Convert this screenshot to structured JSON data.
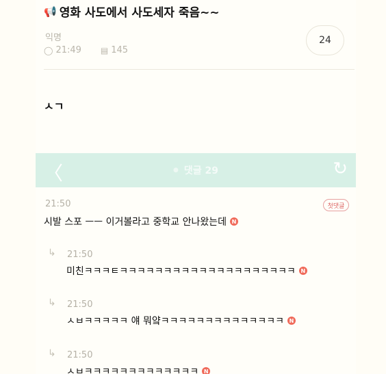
{
  "post": {
    "title": "영화 사도에서 사도세자 죽음~~",
    "author": "익명",
    "time": "21:49",
    "views": "145",
    "count": "24",
    "body": "ㅅㄱ"
  },
  "comments_bar": {
    "label": "댓글 29"
  },
  "comments": [
    {
      "time": "21:50",
      "text": "시발 스포 ㅡㅡ 이거볼라고 중학교 안나왔는데",
      "badge": "첫댓글",
      "reply": false
    },
    {
      "time": "21:50",
      "text": "미친ㅋㅋㅋㅌㅋㅋㅋㅋㅋㅋㅋㅋㅋㅋㅋㅋㅋㅋㅋㅋㅋㅋㅋㅋ",
      "reply": true
    },
    {
      "time": "21:50",
      "text": "ㅅㅂㅋㅋㅋㅋㅋ 얘 뭐얔ㅋㅋㅋㅋㅋㅋㅋㅋㅋㅋㅋㅋㅋㅋ",
      "reply": true
    },
    {
      "time": "21:50",
      "text": "ㅅㅂㅋㅋㅋㅋㅋㅋㅋㅋㅋㅋㅋㅋㅋ",
      "reply": true
    }
  ],
  "badge_letter": "N",
  "colors": {
    "bar": "#d7f0e6",
    "badge": "#f06a5a"
  }
}
